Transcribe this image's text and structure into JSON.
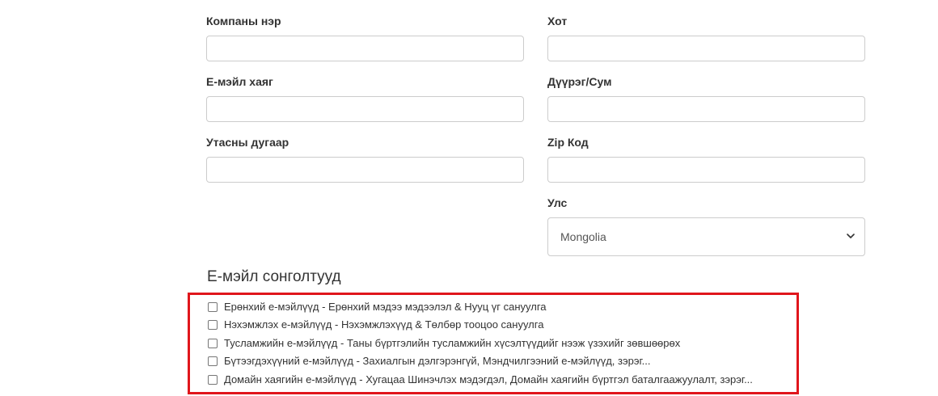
{
  "form": {
    "left_column": [
      {
        "key": "company",
        "label": "Компаны нэр",
        "value": ""
      },
      {
        "key": "email",
        "label": "Е-мэйл хаяг",
        "value": ""
      },
      {
        "key": "phone",
        "label": "Утасны дугаар",
        "value": ""
      }
    ],
    "right_column": [
      {
        "key": "city",
        "label": "Хот",
        "value": ""
      },
      {
        "key": "district",
        "label": "Дүүрэг/Сум",
        "value": ""
      },
      {
        "key": "zip",
        "label": "Zip Код",
        "value": ""
      }
    ],
    "country": {
      "label": "Улс",
      "selected": "Mongolia",
      "icon": "chevron-down-icon"
    }
  },
  "email_preferences": {
    "title": "Е-мэйл сонголтууд",
    "highlight_color": "#e0161c",
    "options": [
      {
        "label": "Ерөнхий е-мэйлүүд - Ерөнхий мэдээ мэдээлэл & Нууц үг сануулга",
        "checked": false
      },
      {
        "label": "Нэхэмжлэх е-мэйлүүд - Нэхэмжлэхүүд & Төлбөр тооцоо сануулга",
        "checked": false
      },
      {
        "label": "Тусламжийн е-мэйлүүд - Таны бүртгэлийн тусламжийн хүсэлтүүдийг нээж үзэхийг зөвшөөрөх",
        "checked": false
      },
      {
        "label": "Бүтээгдэхүүний е-мэйлүүд - Захиалгын дэлгэрэнгүй, Мэндчилгээний е-мэйлүүд, зэрэг...",
        "checked": false
      },
      {
        "label": "Домайн хаягийн е-мэйлүүд - Хугацаа Шинэчлэх мэдэгдэл, Домайн хаягийн бүртгэл баталгаажуулалт, зэрэг...",
        "checked": false
      }
    ]
  }
}
